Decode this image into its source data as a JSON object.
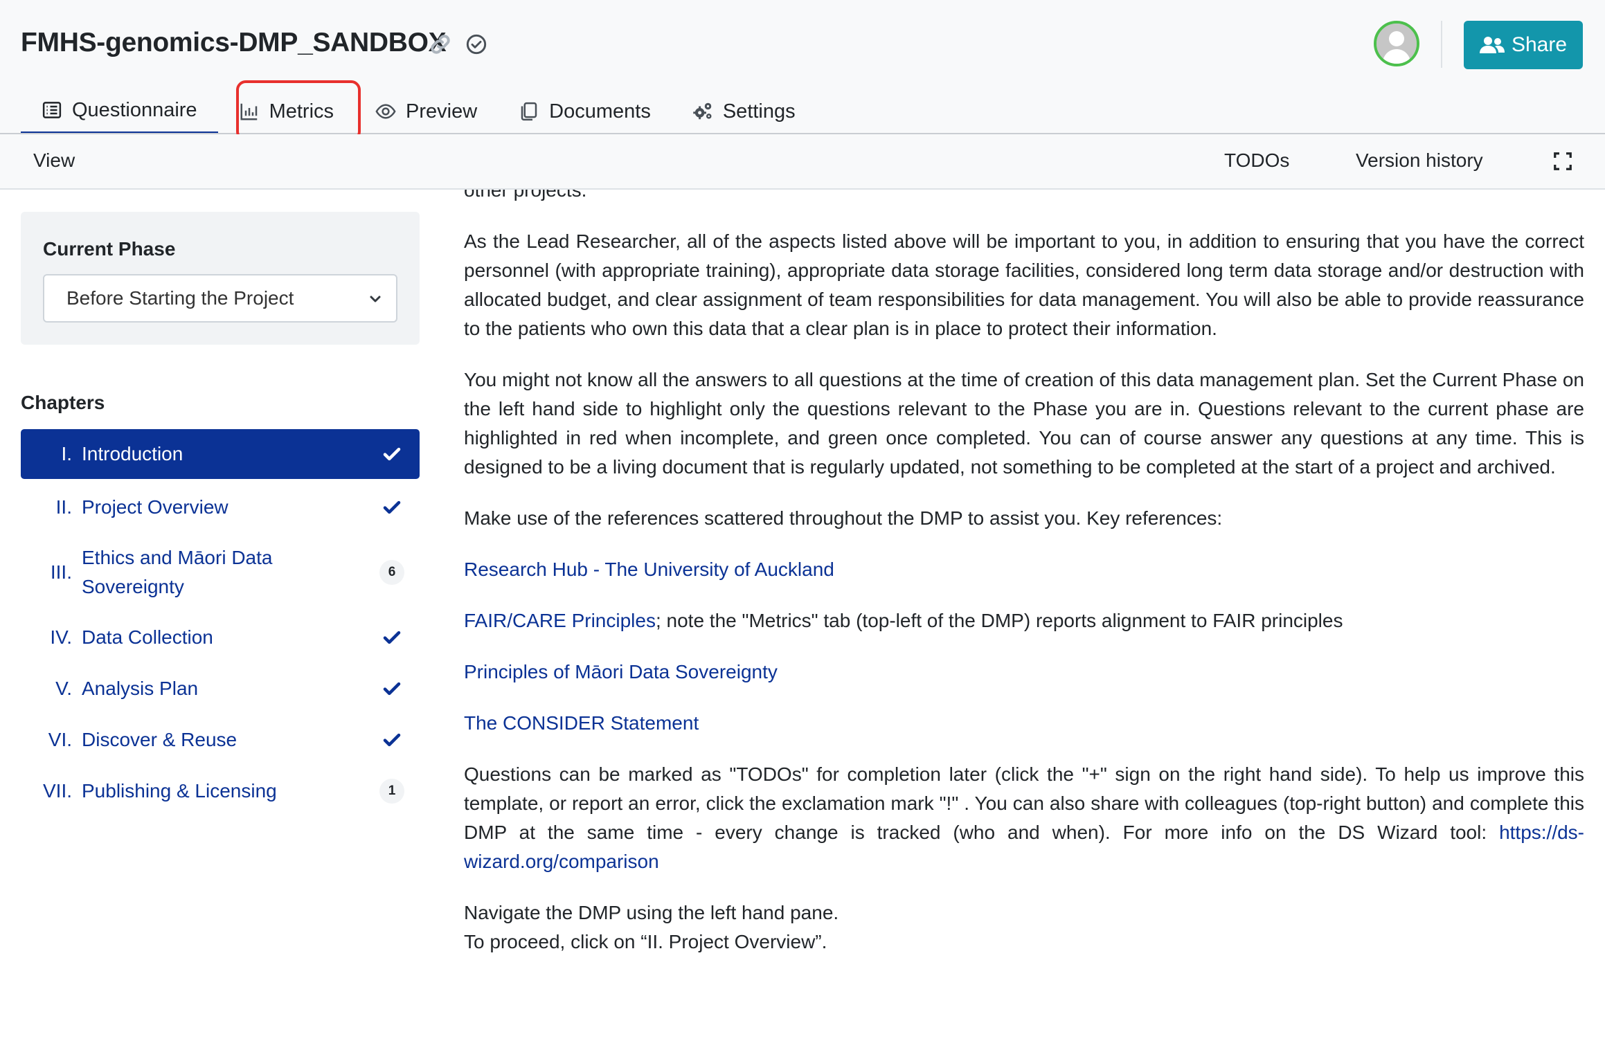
{
  "header": {
    "title": "FMHS-genomics-DMP_SANDBOX",
    "share_label": "Share",
    "accent_color": "#1396ab"
  },
  "tabs": [
    {
      "label": "Questionnaire",
      "icon": "list-icon",
      "active": true
    },
    {
      "label": "Metrics",
      "icon": "chart-icon",
      "active": false
    },
    {
      "label": "Preview",
      "icon": "eye-icon",
      "active": false
    },
    {
      "label": "Documents",
      "icon": "documents-icon",
      "active": false
    },
    {
      "label": "Settings",
      "icon": "gears-icon",
      "active": false
    }
  ],
  "toolbar": {
    "view_label": "View",
    "todos_label": "TODOs",
    "version_history_label": "Version history"
  },
  "sidebar": {
    "phase_label": "Current Phase",
    "phase_value": "Before Starting the Project",
    "chapters_heading": "Chapters",
    "chapters": [
      {
        "num": "I.",
        "label": "Introduction",
        "status": "check",
        "active": true
      },
      {
        "num": "II.",
        "label": "Project Overview",
        "status": "check"
      },
      {
        "num": "III.",
        "label": "Ethics and Māori Data Sovereignty",
        "status": "6"
      },
      {
        "num": "IV.",
        "label": "Data Collection",
        "status": "check"
      },
      {
        "num": "V.",
        "label": "Analysis Plan",
        "status": "check"
      },
      {
        "num": "VI.",
        "label": "Discover & Reuse",
        "status": "check"
      },
      {
        "num": "VII.",
        "label": "Publishing & Licensing",
        "status": "1"
      }
    ]
  },
  "content": {
    "cut_line": "other projects.",
    "para1": "As the Lead Researcher, all of the aspects listed above will be important to you, in addition to ensuring that you have the correct personnel (with appropriate training), appropriate data storage facilities, considered long term data storage and/or destruction with allocated budget, and clear assignment of team responsibilities for data management. You will also be able to provide reassurance to the patients who own this data that a clear plan is in place to protect their information.",
    "para2": "You might not know all the answers to all questions at the time of creation of this data management plan. Set the Current Phase on the left hand side to highlight only the questions relevant to the Phase you are in. Questions relevant to the current phase are highlighted in red when incomplete, and green once completed. You can of course answer any questions at any time. This is designed to be a living document that is regularly updated, not something to be completed at the start of a project and archived.",
    "para3": "Make use of the references scattered throughout the DMP to assist you. Key references:",
    "ref1": "Research Hub - The University of Auckland",
    "ref2_link": "FAIR/CARE Principles",
    "ref2_rest": "; note the \"Metrics\" tab (top-left of the DMP) reports alignment to FAIR principles",
    "ref3": "Principles of Māori Data Sovereignty",
    "ref4": "The CONSIDER Statement",
    "para4": "Questions can be marked as \"TODOs\" for completion later (click the \"+\" sign on the right hand side). To help us improve this template, or report an error, click the exclamation mark \"!\" . You can also share with colleagues (top-right button) and complete this DMP at the same time - every change is tracked (who and when). For more info on the DS Wizard tool:",
    "para4_link": "https://ds-wizard.org/comparison",
    "para5_line1": "Navigate the DMP using the left hand pane.",
    "para5_line2": "To proceed, click on “II. Project Overview”."
  }
}
